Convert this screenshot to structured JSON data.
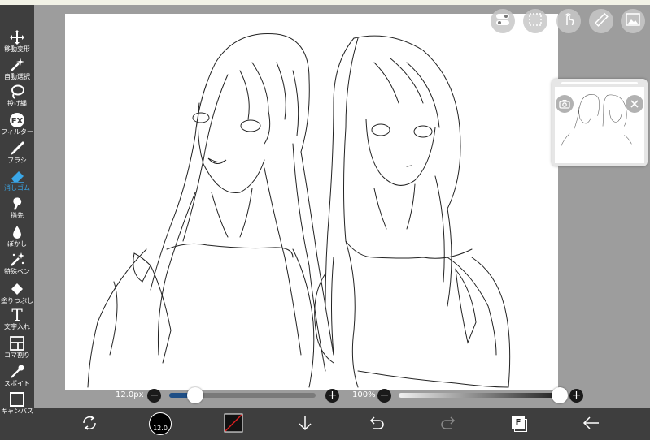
{
  "toolbar": {
    "items": [
      {
        "icon": "move-transform-icon",
        "label": "移動変形"
      },
      {
        "icon": "magic-wand-icon",
        "label": "自動選択"
      },
      {
        "icon": "lasso-icon",
        "label": "投げ縄"
      },
      {
        "icon": "fx-icon",
        "label": "フィルター",
        "glyph": "FX"
      },
      {
        "icon": "brush-icon",
        "label": "ブラシ"
      },
      {
        "icon": "eraser-icon",
        "label": "消しゴム",
        "active": true
      },
      {
        "icon": "smudge-icon",
        "label": "指先"
      },
      {
        "icon": "blur-icon",
        "label": "ぼかし"
      },
      {
        "icon": "special-pen-icon",
        "label": "特殊ペン"
      },
      {
        "icon": "fill-bucket-icon",
        "label": "塗りつぶし"
      },
      {
        "icon": "text-icon",
        "label": "文字入れ",
        "glyph": "T"
      },
      {
        "icon": "frame-divider-icon",
        "label": "コマ割り"
      },
      {
        "icon": "eyedropper-icon",
        "label": "スポイト"
      },
      {
        "icon": "canvas-icon",
        "label": "キャンバス"
      }
    ],
    "active_color": "#3aa7e8"
  },
  "top_buttons": [
    {
      "icon": "toggle-panel-icon"
    },
    {
      "icon": "selection-icon"
    },
    {
      "icon": "touch-gesture-icon"
    },
    {
      "icon": "ruler-icon"
    },
    {
      "icon": "gallery-icon"
    }
  ],
  "navigator": {
    "camera_icon": "camera-icon",
    "close_icon": "close-icon"
  },
  "sliders": {
    "brush_size_text": "12.0px",
    "brush_size_fraction": 0.18,
    "opacity_text": "100%",
    "opacity_fraction": 1.0,
    "minus": "−",
    "plus": "+"
  },
  "bottom_bar": {
    "brush_preview_text": "12.0",
    "buttons": [
      {
        "icon": "transform-arrows-icon"
      },
      {
        "icon": "brush-size-preview-icon"
      },
      {
        "icon": "color-swatch-icon"
      },
      {
        "icon": "download-arrow-icon"
      },
      {
        "icon": "undo-icon"
      },
      {
        "icon": "redo-icon"
      },
      {
        "icon": "layers-icon",
        "glyph": "F"
      },
      {
        "icon": "back-arrow-icon"
      }
    ]
  }
}
